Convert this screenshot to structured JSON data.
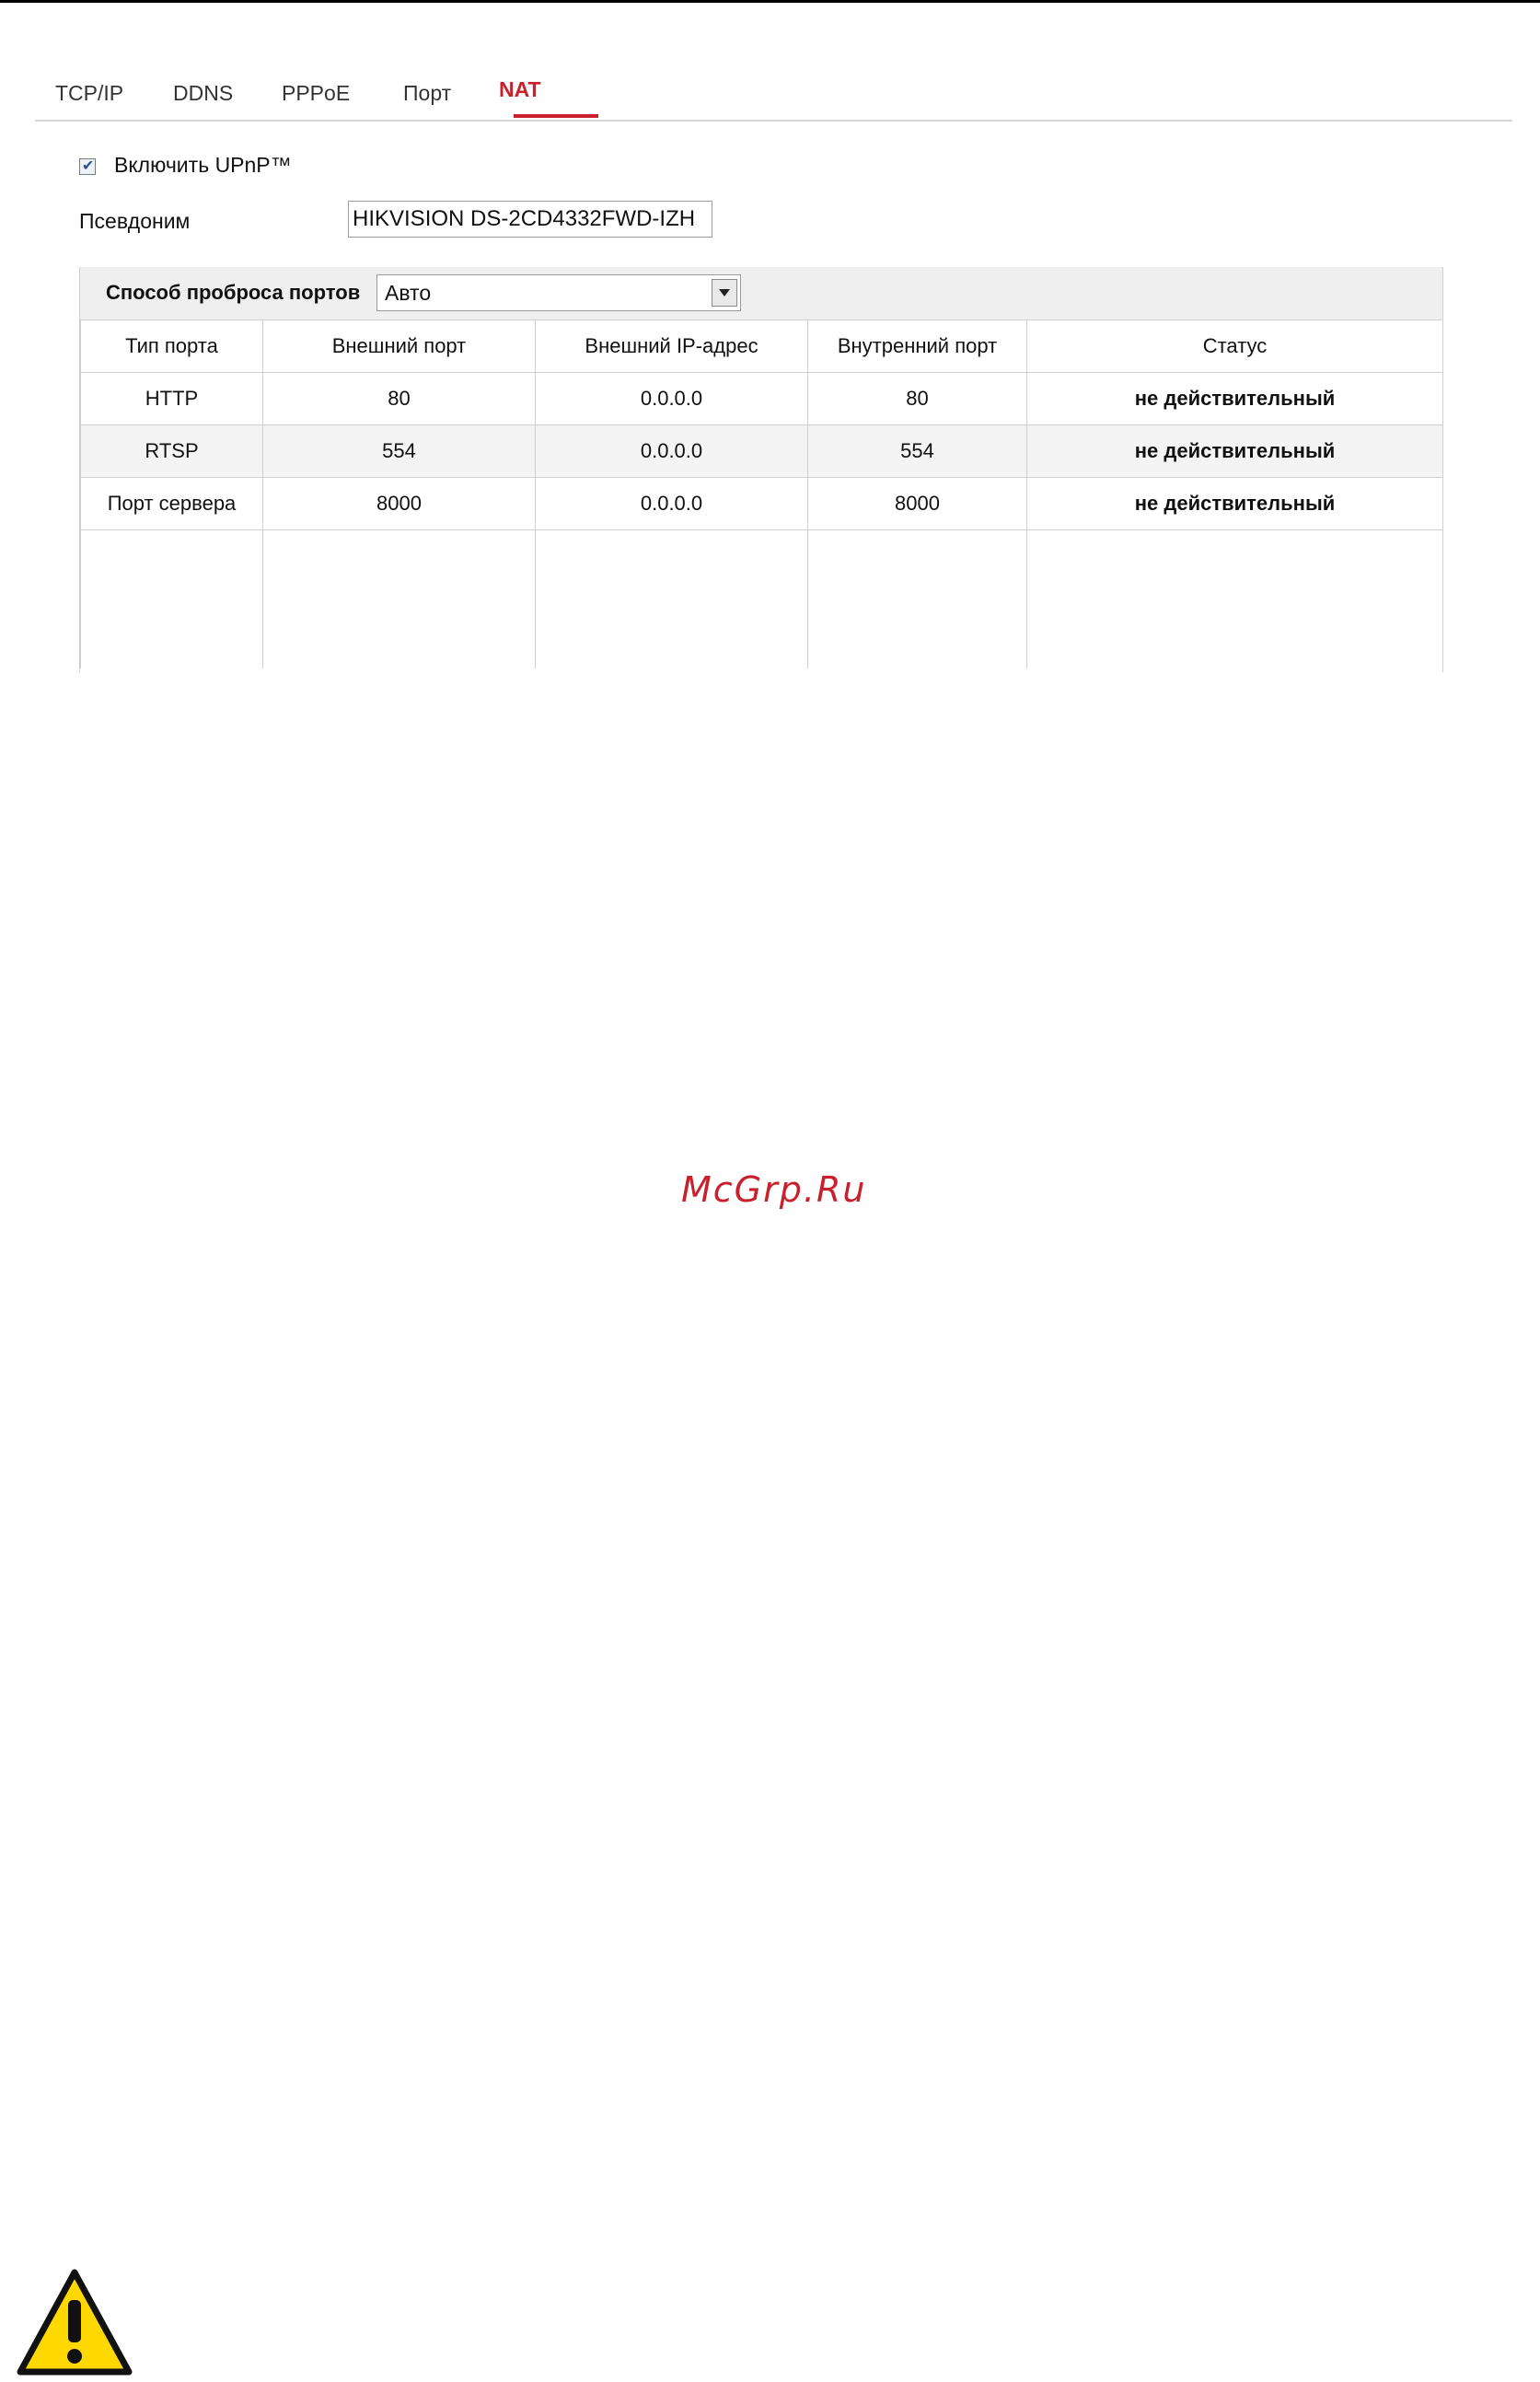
{
  "tabs": [
    {
      "label": "TCP/IP"
    },
    {
      "label": "DDNS"
    },
    {
      "label": "PPPoE"
    },
    {
      "label": "Порт"
    },
    {
      "label": "NAT"
    }
  ],
  "upnp": {
    "label": "Включить UPnP™",
    "checked": true
  },
  "alias": {
    "label": "Псевдоним",
    "value": "HIKVISION DS-2CD4332FWD-IZH"
  },
  "mapping": {
    "label": "Способ проброса портов",
    "selected": "Авто"
  },
  "table": {
    "headers": [
      "Тип порта",
      "Внешний порт",
      "Внешний IP-адрес",
      "Внутренний порт",
      "Статус"
    ],
    "rows": [
      [
        "HTTP",
        "80",
        "0.0.0.0",
        "80",
        "не действительный"
      ],
      [
        "RTSP",
        "554",
        "0.0.0.0",
        "554",
        "не действительный"
      ],
      [
        "Порт сервера",
        "8000",
        "0.0.0.0",
        "8000",
        "не действительный"
      ]
    ]
  },
  "watermark": "McGrp.Ru",
  "icons": {
    "warning": "warning-icon",
    "check": "checkmark-icon",
    "dropdown": "chevron-down-icon"
  },
  "colors": {
    "accent": "#c8202c",
    "warning_yellow": "#ffd800"
  }
}
